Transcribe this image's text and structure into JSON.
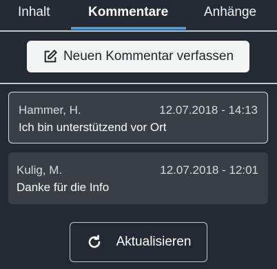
{
  "tabs": [
    {
      "label": "Inhalt"
    },
    {
      "label": "Kommentare",
      "active": true
    },
    {
      "label": "Anhänge"
    }
  ],
  "actions": {
    "new_comment_label": "Neuen Kommentar verfassen",
    "new_comment_icon": "edit-icon",
    "refresh_label": "Aktualisieren",
    "refresh_icon": "refresh-icon"
  },
  "comments": [
    {
      "author": "Hammer, H.",
      "timestamp": "12.07.2018 - 14:13",
      "text": "Ich bin unterstützend vor Ort",
      "selected": true
    },
    {
      "author": "Kulig, M.",
      "timestamp": "12.07.2018 - 12:01",
      "text": "Danke für die Info"
    }
  ],
  "colors": {
    "background": "#242a33",
    "accent": "#4a9ad6",
    "card": "#3a3f47"
  }
}
